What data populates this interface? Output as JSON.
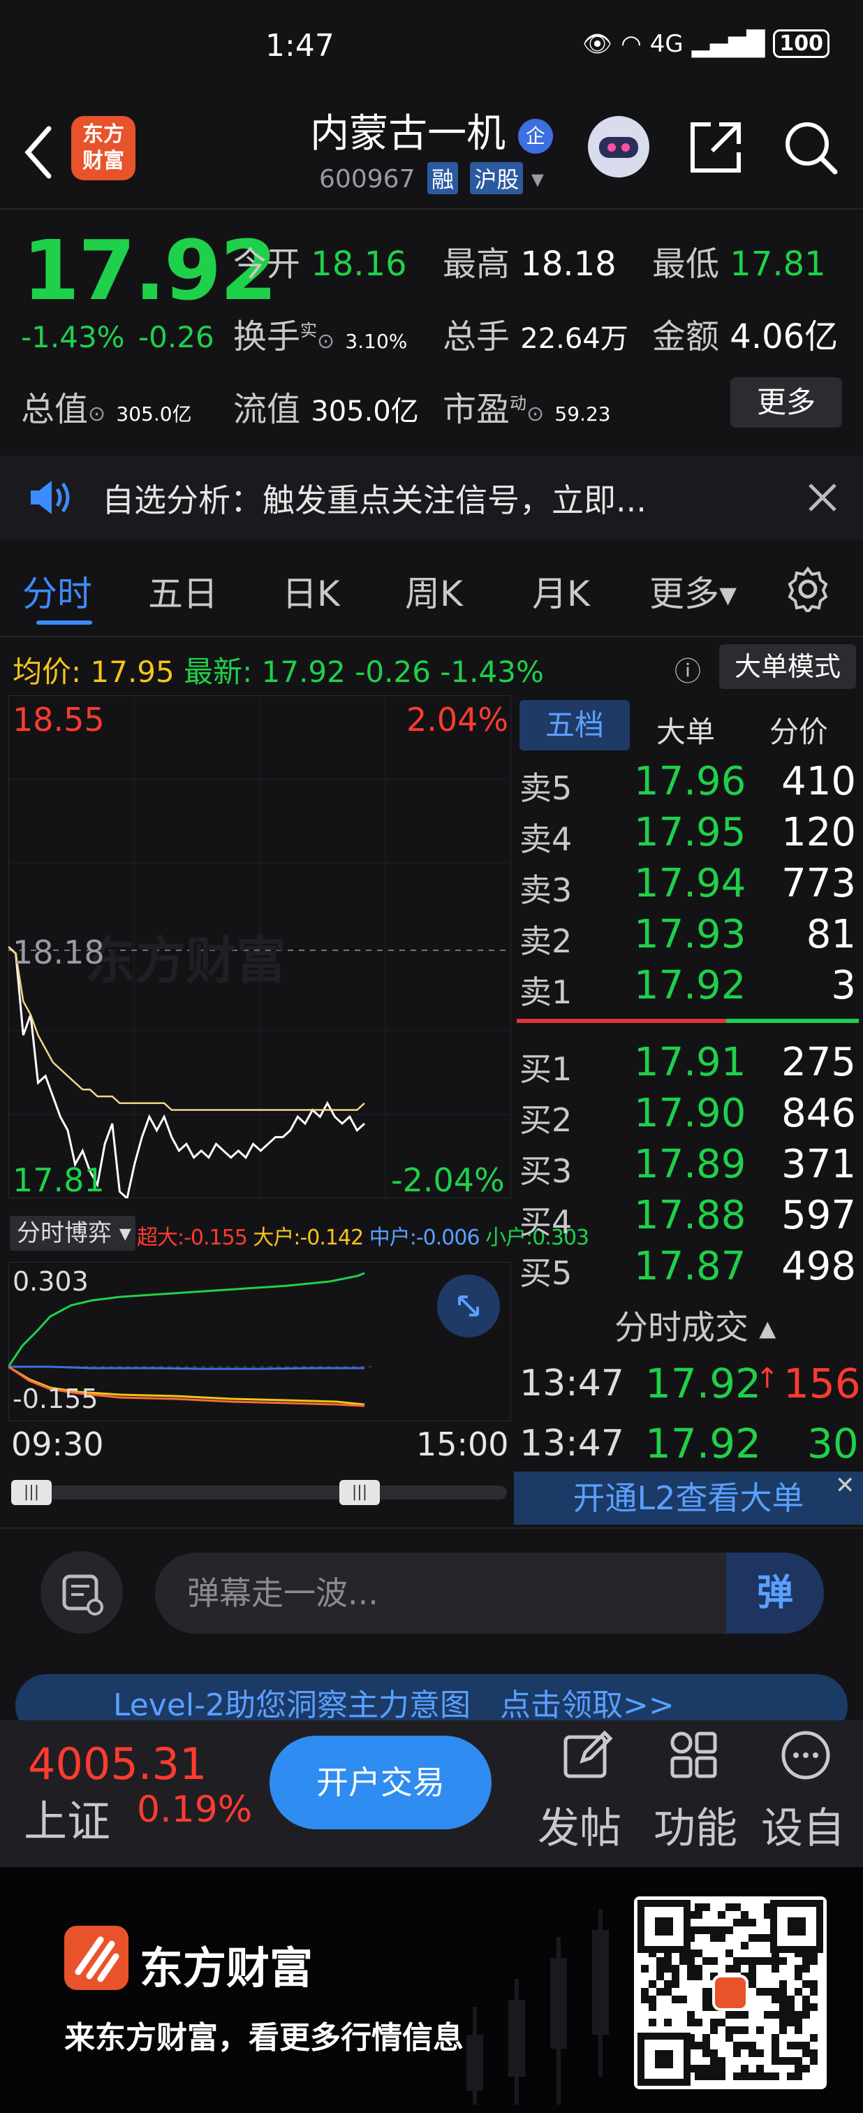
{
  "status_bar": {
    "time": "1:47",
    "network": "4G",
    "battery": "100"
  },
  "header": {
    "title": "内蒙古一机",
    "code": "600967",
    "badge1": "融",
    "badge2": "沪股",
    "logo_line1": "东方",
    "logo_line2": "财富",
    "tag": "企"
  },
  "quote": {
    "price": "17.92",
    "change_pct": "-1.43%",
    "change": "-0.26",
    "open_label": "今开",
    "open": "18.16",
    "high_label": "最高",
    "high": "18.18",
    "low_label": "最低",
    "low": "17.81",
    "turnover_label": "换手",
    "turnover_sup": "实",
    "turnover": "3.10%",
    "volume_label": "总手",
    "volume": "22.64万",
    "amount_label": "金额",
    "amount": "4.06亿",
    "mktcap_label": "总值",
    "mktcap": "305.0亿",
    "float_label": "流值",
    "float": "305.0亿",
    "pe_label": "市盈",
    "pe_sup": "动",
    "pe": "59.23",
    "more": "更多"
  },
  "notice": {
    "text": "自选分析：触发重点关注信号，立即..."
  },
  "tabs": [
    "分时",
    "五日",
    "日K",
    "周K",
    "月K",
    "更多▾"
  ],
  "chart_header": {
    "avg_label": "均价:",
    "avg": "17.95",
    "latest_label": "最新:",
    "latest": "17.92",
    "change": "-0.26",
    "change_pct": "-1.43%",
    "bigorder_mode": "大单模式"
  },
  "chart_data": {
    "type": "line",
    "title": "",
    "y_labels": {
      "top": "18.55",
      "mid": "18.18",
      "bottom": "17.81",
      "top_pct": "2.04%",
      "bottom_pct": "-2.04%"
    },
    "ylim": [
      17.81,
      18.55
    ],
    "series": [
      {
        "name": "最新",
        "color": "#ffffff",
        "values": [
          18.18,
          18.17,
          18.05,
          18.08,
          17.98,
          17.99,
          17.96,
          17.93,
          17.91,
          17.86,
          17.88,
          17.85,
          17.83,
          17.89,
          17.92,
          17.82,
          17.81,
          17.86,
          17.9,
          17.93,
          17.91,
          17.93,
          17.9,
          17.88,
          17.89,
          17.87,
          17.88,
          17.87,
          17.89,
          17.88,
          17.87,
          17.88,
          17.87,
          17.89,
          17.88,
          17.89,
          17.9,
          17.9,
          17.91,
          17.93,
          17.92,
          17.94,
          17.93,
          17.95,
          17.93,
          17.92,
          17.93,
          17.91,
          17.92
        ]
      },
      {
        "name": "均价",
        "color": "#f5d58a",
        "values": [
          18.18,
          18.17,
          18.1,
          18.08,
          18.05,
          18.03,
          18.01,
          18.0,
          17.99,
          17.98,
          17.97,
          17.97,
          17.96,
          17.96,
          17.96,
          17.95,
          17.95,
          17.95,
          17.95,
          17.95,
          17.95,
          17.95,
          17.94,
          17.94,
          17.94,
          17.94,
          17.94,
          17.94,
          17.94,
          17.94,
          17.94,
          17.94,
          17.94,
          17.94,
          17.94,
          17.94,
          17.94,
          17.94,
          17.94,
          17.94,
          17.94,
          17.94,
          17.94,
          17.94,
          17.94,
          17.94,
          17.94,
          17.94,
          17.95
        ]
      }
    ]
  },
  "orderbook": {
    "tabs": [
      "五档",
      "大单",
      "分价"
    ],
    "asks": [
      {
        "label": "卖5",
        "price": "17.96",
        "vol": "410"
      },
      {
        "label": "卖4",
        "price": "17.95",
        "vol": "120"
      },
      {
        "label": "卖3",
        "price": "17.94",
        "vol": "773"
      },
      {
        "label": "卖2",
        "price": "17.93",
        "vol": "81"
      },
      {
        "label": "卖1",
        "price": "17.92",
        "vol": "3"
      }
    ],
    "bids": [
      {
        "label": "买1",
        "price": "17.91",
        "vol": "275"
      },
      {
        "label": "买2",
        "price": "17.90",
        "vol": "846"
      },
      {
        "label": "买3",
        "price": "17.89",
        "vol": "371"
      },
      {
        "label": "买4",
        "price": "17.88",
        "vol": "597"
      },
      {
        "label": "买5",
        "price": "17.87",
        "vol": "498"
      }
    ]
  },
  "trades": {
    "title": "分时成交",
    "rows": [
      {
        "time": "13:47",
        "price": "17.92",
        "vol": "156"
      },
      {
        "time": "13:47",
        "price": "17.92",
        "vol": "30"
      }
    ],
    "l2_text": "开通L2查看大单"
  },
  "game": {
    "label": "分时博弈",
    "super_label": "超大:",
    "super": "-0.155",
    "large_label": "大户:",
    "large": "-0.142",
    "mid_label": "中户:",
    "mid": "-0.006",
    "small_label": "小户:",
    "small": "0.303",
    "y_top": "0.303",
    "y_bottom": "-0.155",
    "x_start": "09:30",
    "x_end": "15:00"
  },
  "danmu": {
    "placeholder": "弹幕走一波...",
    "button": "弹"
  },
  "promo": {
    "text": "Level-2助您洞察主力意图",
    "link": "点击领取>>"
  },
  "index": {
    "value": "4005.31",
    "name": "上证",
    "change_pct": "0.19%"
  },
  "nav": {
    "open_btn": "开户交易",
    "post": "发帖",
    "func": "功能",
    "settings": "设自"
  },
  "footer": {
    "brand": "东方财富",
    "slogan": "来东方财富，看更多行情信息"
  }
}
